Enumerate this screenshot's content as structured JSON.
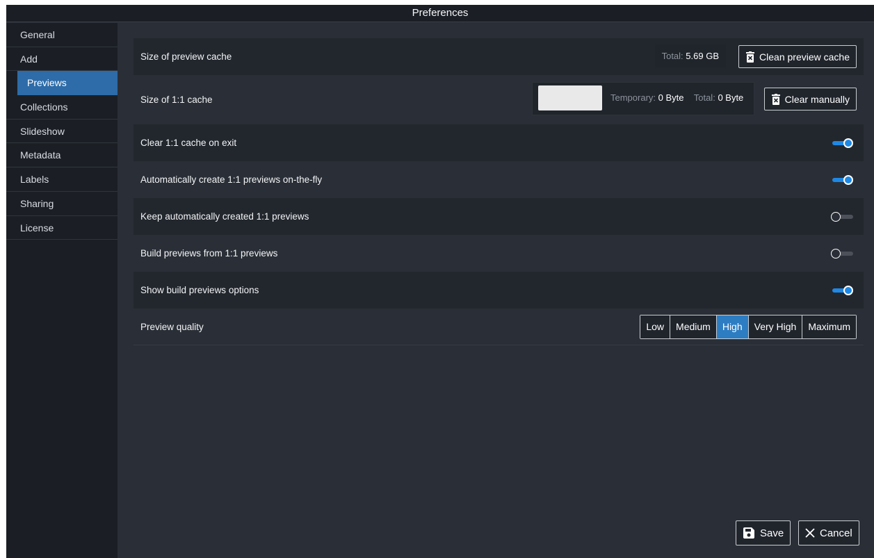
{
  "window": {
    "title": "Preferences"
  },
  "sidebar": {
    "items": [
      {
        "label": "General"
      },
      {
        "label": "Add"
      },
      {
        "label": "Previews",
        "active": true
      },
      {
        "label": "Collections"
      },
      {
        "label": "Slideshow"
      },
      {
        "label": "Metadata"
      },
      {
        "label": "Labels"
      },
      {
        "label": "Sharing"
      },
      {
        "label": "License"
      }
    ]
  },
  "previews": {
    "preview_cache": {
      "label": "Size of preview cache",
      "total_label": "Total:",
      "total_value": "5.69 GB",
      "clean_button": "Clean preview cache"
    },
    "one_to_one_cache": {
      "label": "Size of 1:1 cache",
      "temporary_label": "Temporary:",
      "temporary_value": "0 Byte",
      "total_label": "Total:",
      "total_value": "0 Byte",
      "clear_button": "Clear manually"
    },
    "clear_on_exit": {
      "label": "Clear 1:1 cache on exit",
      "enabled": true
    },
    "auto_create": {
      "label": "Automatically create 1:1 previews on-the-fly",
      "enabled": true
    },
    "keep_auto": {
      "label": "Keep automatically created 1:1 previews",
      "enabled": false
    },
    "build_from": {
      "label": "Build previews from 1:1 previews",
      "enabled": false
    },
    "show_build_options": {
      "label": "Show build previews options",
      "enabled": true
    },
    "preview_quality": {
      "label": "Preview quality",
      "options": [
        "Low",
        "Medium",
        "High",
        "Very High",
        "Maximum"
      ],
      "selected": "High"
    }
  },
  "footer": {
    "save_label": "Save",
    "cancel_label": "Cancel"
  },
  "colors": {
    "accent": "#1e88e5",
    "selected_nav": "#2d6ca8",
    "background": "#2a2f37",
    "sidebar": "#1b1f25"
  }
}
